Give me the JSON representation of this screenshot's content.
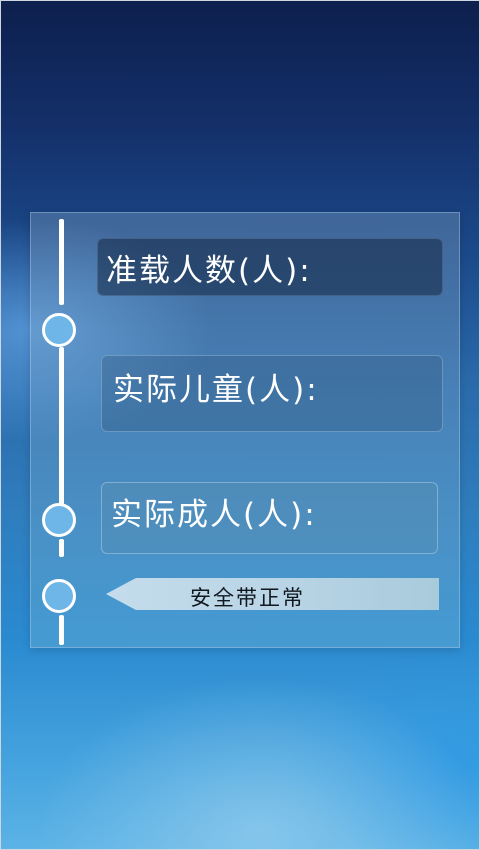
{
  "fields": {
    "rated_capacity": {
      "label": "准载人数(人):",
      "value": ""
    },
    "actual_children": {
      "label": "实际儿童(人):",
      "value": ""
    },
    "actual_adults": {
      "label": "实际成人(人):",
      "value": ""
    }
  },
  "status": {
    "text": "安全带正常"
  },
  "colors": {
    "node_fill": "#6fb6e8",
    "timeline": "#ffffff",
    "background_top": "#0d1f4d",
    "background_bottom": "#5cb3e6"
  }
}
